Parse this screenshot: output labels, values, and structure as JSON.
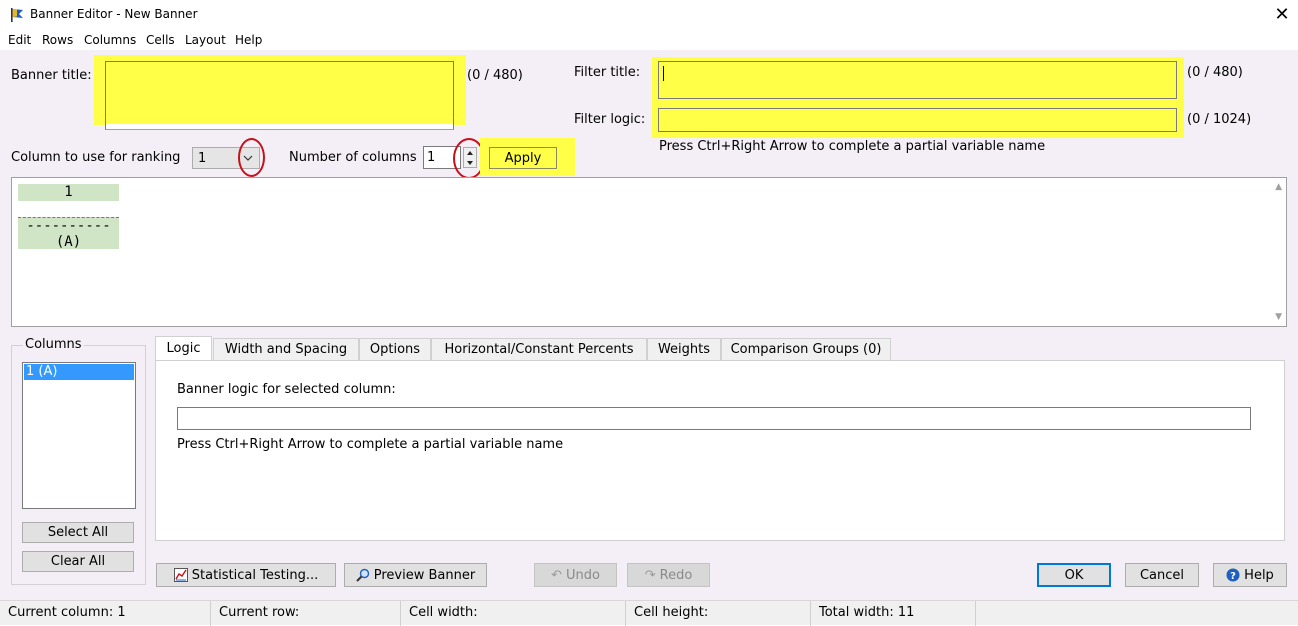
{
  "window": {
    "title": "Banner Editor - New Banner"
  },
  "menu": [
    "Edit",
    "Rows",
    "Columns",
    "Cells",
    "Layout",
    "Help"
  ],
  "banner_title": {
    "label": "Banner title:",
    "value": "",
    "counter": "(0 / 480)"
  },
  "filter_title": {
    "label": "Filter title:",
    "value": "",
    "counter": "(0 / 480)"
  },
  "filter_logic": {
    "label": "Filter logic:",
    "value": "",
    "counter": "(0 / 1024)",
    "hint": "Press Ctrl+Right Arrow to complete a partial variable name"
  },
  "ranking": {
    "label": "Column to use for ranking",
    "value": "1"
  },
  "num_columns": {
    "label": "Number of columns",
    "value": "1"
  },
  "apply_label": "Apply",
  "preview": {
    "header": "1",
    "divider": "----------",
    "letter": "(A)"
  },
  "columns_group": {
    "title": "Columns",
    "items": [
      "1 (A)"
    ],
    "select_all": "Select All",
    "clear_all": "Clear All"
  },
  "tabs": [
    "Logic",
    "Width and Spacing",
    "Options",
    "Horizontal/Constant Percents",
    "Weights",
    "Comparison Groups (0)"
  ],
  "logic_panel": {
    "label": "Banner logic for selected column:",
    "value": "",
    "hint": "Press Ctrl+Right Arrow to complete a partial variable name"
  },
  "buttons": {
    "stat_testing": "Statistical Testing...",
    "preview_banner": "Preview Banner",
    "undo": "Undo",
    "redo": "Redo",
    "ok": "OK",
    "cancel": "Cancel",
    "help": "Help"
  },
  "status": {
    "current_column": "Current column: 1",
    "current_row": "Current row:",
    "cell_width": "Cell width:",
    "cell_height": "Cell height:",
    "total_width": "Total width: 11"
  },
  "colors": {
    "highlight": "#ffff48",
    "annotation": "#c8101a",
    "selection": "#3399ff",
    "preview_cell": "#d0e5c6"
  }
}
